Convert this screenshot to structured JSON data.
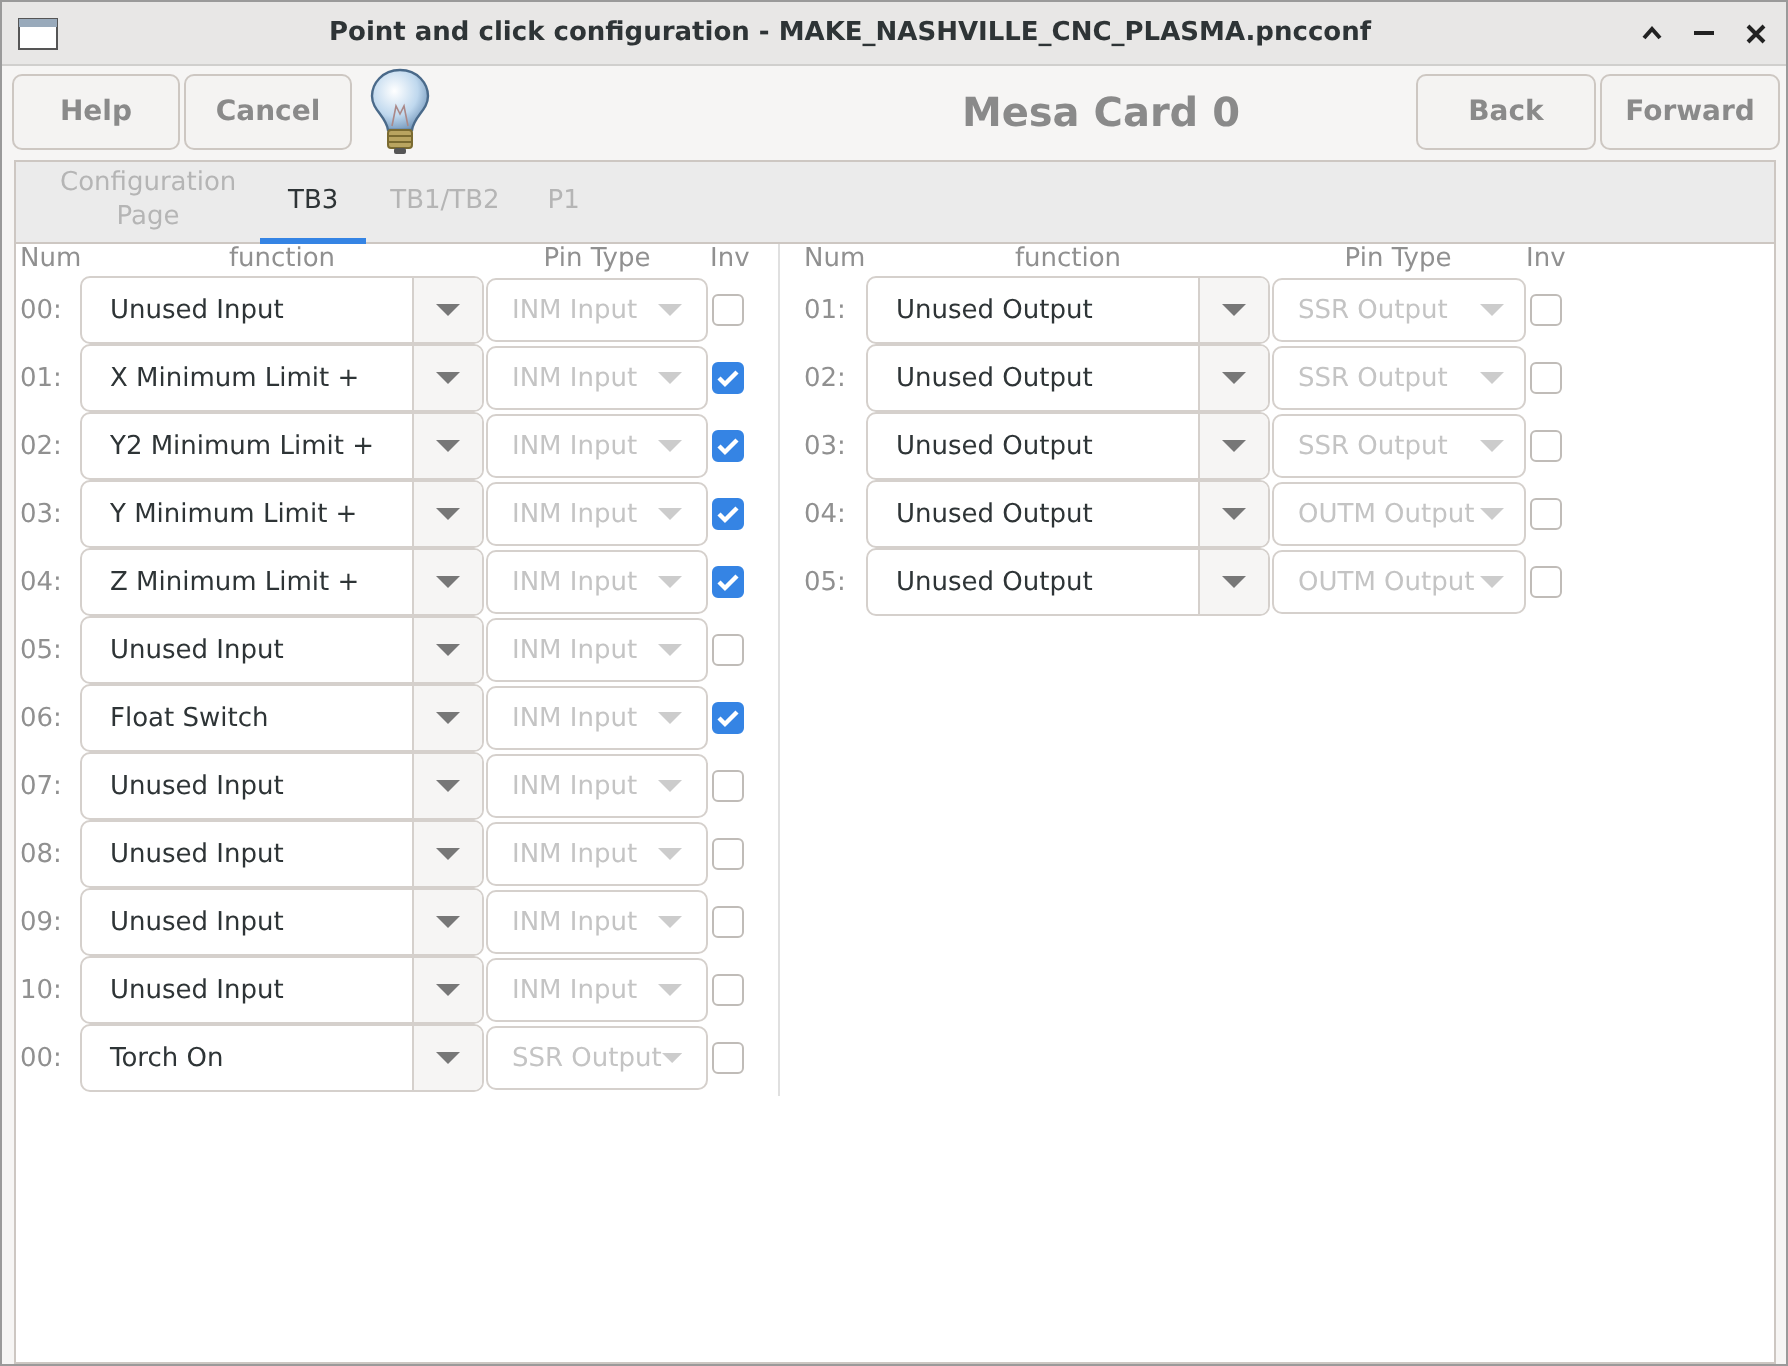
{
  "window": {
    "title": "Point and click configuration - MAKE_NASHVILLE_CNC_PLASMA.pncconf"
  },
  "toolbar": {
    "left_buttons": [
      "Help",
      "Cancel"
    ],
    "heading": "Mesa Card 0",
    "right_buttons": [
      "Back",
      "Forward"
    ]
  },
  "tabs": [
    {
      "label": "Configuration Page",
      "selected": false
    },
    {
      "label": "TB3",
      "selected": true
    },
    {
      "label": "TB1/TB2",
      "selected": false
    },
    {
      "label": "P1",
      "selected": false
    }
  ],
  "columns": [
    "Num",
    "function",
    "Pin Type",
    "Inv"
  ],
  "inputs": [
    {
      "num": "00:",
      "function": "Unused Input",
      "pin_type": "INM Input",
      "pin_disabled": true,
      "inv": false
    },
    {
      "num": "01:",
      "function": "X Minimum Limit +",
      "pin_type": "INM Input",
      "pin_disabled": true,
      "inv": true
    },
    {
      "num": "02:",
      "function": "Y2 Minimum Limit +",
      "pin_type": "INM Input",
      "pin_disabled": true,
      "inv": true
    },
    {
      "num": "03:",
      "function": "Y Minimum Limit +",
      "pin_type": "INM Input",
      "pin_disabled": true,
      "inv": true
    },
    {
      "num": "04:",
      "function": "Z Minimum Limit +",
      "pin_type": "INM Input",
      "pin_disabled": true,
      "inv": true
    },
    {
      "num": "05:",
      "function": "Unused Input",
      "pin_type": "INM Input",
      "pin_disabled": true,
      "inv": false
    },
    {
      "num": "06:",
      "function": "Float Switch",
      "pin_type": "INM Input",
      "pin_disabled": true,
      "inv": true
    },
    {
      "num": "07:",
      "function": "Unused Input",
      "pin_type": "INM Input",
      "pin_disabled": true,
      "inv": false
    },
    {
      "num": "08:",
      "function": "Unused Input",
      "pin_type": "INM Input",
      "pin_disabled": true,
      "inv": false
    },
    {
      "num": "09:",
      "function": "Unused Input",
      "pin_type": "INM Input",
      "pin_disabled": true,
      "inv": false
    },
    {
      "num": "10:",
      "function": "Unused Input",
      "pin_type": "INM Input",
      "pin_disabled": true,
      "inv": false
    },
    {
      "num": "00:",
      "function": "Torch On",
      "pin_type": "SSR Output",
      "pin_disabled": true,
      "inv": false
    }
  ],
  "right_columns": [
    "Num",
    "function",
    "Pin Type",
    "Inv"
  ],
  "outputs": [
    {
      "num": "01:",
      "function": "Unused Output",
      "pin_type": "SSR Output",
      "pin_disabled": true,
      "inv": false
    },
    {
      "num": "02:",
      "function": "Unused Output",
      "pin_type": "SSR Output",
      "pin_disabled": true,
      "inv": false
    },
    {
      "num": "03:",
      "function": "Unused Output",
      "pin_type": "SSR Output",
      "pin_disabled": true,
      "inv": false
    },
    {
      "num": "04:",
      "function": "Unused Output",
      "pin_type": "OUTM Output",
      "pin_disabled": true,
      "inv": false
    },
    {
      "num": "05:",
      "function": "Unused Output",
      "pin_type": "OUTM Output",
      "pin_disabled": true,
      "inv": false
    }
  ]
}
